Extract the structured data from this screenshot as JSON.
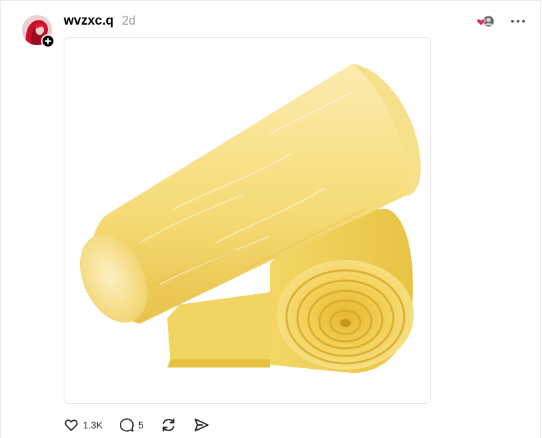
{
  "post": {
    "author": {
      "username": "wvzxc.q",
      "avatar_icon": "avatar-red-hair"
    },
    "time_ago": "2d",
    "media": {
      "subject": "yellow fiberglass insulation rolls"
    },
    "actions": {
      "like_count": "1.3K",
      "comment_count": "5"
    }
  },
  "colors": {
    "heart": "#e0245e",
    "text_muted": "#999999",
    "insulation_light": "#fbe9a0",
    "insulation_mid": "#f2d060",
    "insulation_dark": "#d9b13a"
  }
}
